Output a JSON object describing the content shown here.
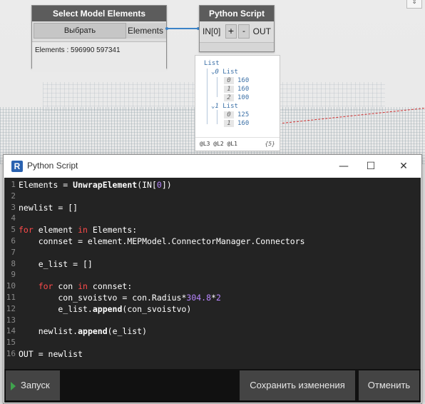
{
  "canvas": {
    "corner_icon": "expand-icon"
  },
  "select_node": {
    "title": "Select Model Elements",
    "button_label": "Выбрать",
    "output_port": "Elements",
    "info": "Elements : 596990 597341"
  },
  "python_node": {
    "title": "Python Script",
    "input_port": "IN[0]",
    "add_label": "+",
    "remove_label": "-",
    "output_port": "OUT"
  },
  "preview": {
    "root": "List",
    "groups": [
      {
        "index": "0",
        "label": "List",
        "items": [
          {
            "i": "0",
            "v": "160"
          },
          {
            "i": "1",
            "v": "160"
          },
          {
            "i": "2",
            "v": "100"
          }
        ]
      },
      {
        "index": "1",
        "label": "List",
        "items": [
          {
            "i": "0",
            "v": "125"
          },
          {
            "i": "1",
            "v": "160"
          }
        ]
      }
    ],
    "levels": "@L3 @L2 @L1",
    "count": "{5}"
  },
  "window": {
    "title": "Python Script",
    "minimize": "—",
    "maximize": "☐",
    "close": "✕"
  },
  "code_lines": [
    {
      "n": "1",
      "t": "Elements = UnwrapElement(IN[0])"
    },
    {
      "n": "2",
      "t": ""
    },
    {
      "n": "3",
      "t": "newlist = []"
    },
    {
      "n": "4",
      "t": ""
    },
    {
      "n": "5",
      "t": "for element in Elements:"
    },
    {
      "n": "6",
      "t": "    connset = element.MEPModel.ConnectorManager.Connectors"
    },
    {
      "n": "7",
      "t": ""
    },
    {
      "n": "8",
      "t": "    e_list = []"
    },
    {
      "n": "9",
      "t": ""
    },
    {
      "n": "10",
      "t": "    for con in connset:"
    },
    {
      "n": "11",
      "t": "        con_svoistvo = con.Radius*304.8*2"
    },
    {
      "n": "12",
      "t": "        e_list.append(con_svoistvo)"
    },
    {
      "n": "13",
      "t": ""
    },
    {
      "n": "14",
      "t": "    newlist.append(e_list)"
    },
    {
      "n": "15",
      "t": ""
    },
    {
      "n": "16",
      "t": "OUT = newlist"
    }
  ],
  "buttons": {
    "run": "Запуск",
    "save": "Сохранить изменения",
    "cancel": "Отменить"
  }
}
